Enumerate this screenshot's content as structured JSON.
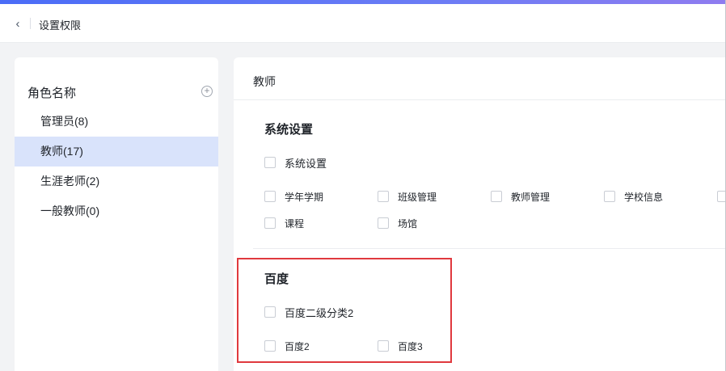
{
  "header": {
    "back_icon": "chevron-left-icon",
    "title": "设置权限"
  },
  "roles": {
    "title": "角色名称",
    "add_icon": "plus-circle-icon",
    "items": [
      {
        "label": "管理员(8)",
        "active": false
      },
      {
        "label": "教师(17)",
        "active": true
      },
      {
        "label": "生涯老师(2)",
        "active": false
      },
      {
        "label": "一般教师(0)",
        "active": false
      }
    ]
  },
  "content": {
    "role_name": "教师",
    "sections": [
      {
        "title": "系统设置",
        "group": {
          "label": "系统设置",
          "checked": false
        },
        "items": [
          {
            "label": "学年学期",
            "checked": false
          },
          {
            "label": "班级管理",
            "checked": false
          },
          {
            "label": "教师管理",
            "checked": false
          },
          {
            "label": "学校信息",
            "checked": false
          },
          {
            "label": "",
            "checked": false
          },
          {
            "label": "课程",
            "checked": false
          },
          {
            "label": "场馆",
            "checked": false
          }
        ]
      },
      {
        "title": "百度",
        "group": {
          "label": "百度二级分类2",
          "checked": false
        },
        "items": [
          {
            "label": "百度2",
            "checked": false
          },
          {
            "label": "百度3",
            "checked": false
          }
        ]
      }
    ]
  },
  "colors": {
    "accent": "#4a6cf7",
    "active_role_bg": "#d9e3fb",
    "highlight_border": "#e0393e"
  }
}
